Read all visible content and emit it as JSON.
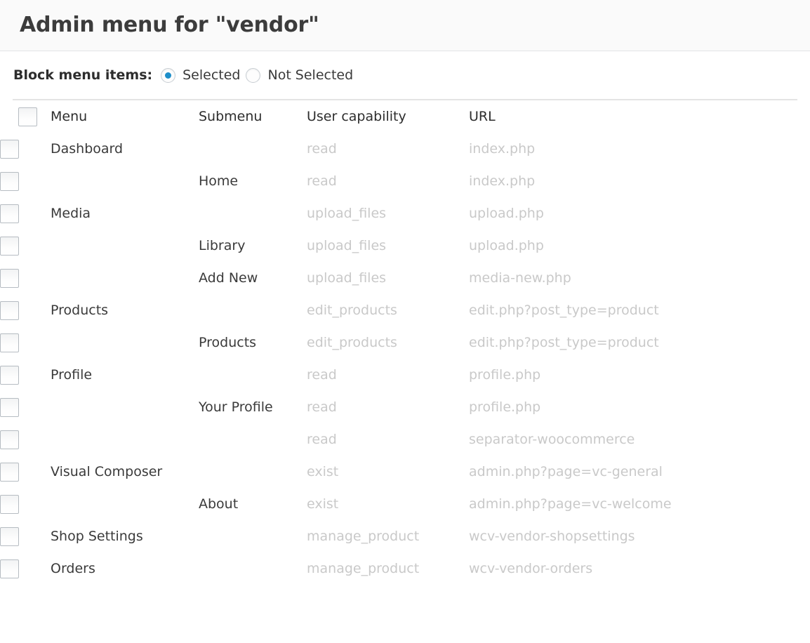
{
  "header": {
    "title": "Admin menu for \"vendor\""
  },
  "filter": {
    "label": "Block menu items:",
    "options": [
      {
        "label": "Selected",
        "checked": true
      },
      {
        "label": "Not Selected",
        "checked": false
      }
    ],
    "accent_color": "#1d8ec9"
  },
  "table": {
    "columns": {
      "checkbox": "",
      "menu": "Menu",
      "submenu": "Submenu",
      "capability": "User capability",
      "url": "URL"
    },
    "rows": [
      {
        "checked": false,
        "menu": "Dashboard",
        "submenu": "",
        "capability": "read",
        "url": "index.php"
      },
      {
        "checked": false,
        "menu": "",
        "submenu": "Home",
        "capability": "read",
        "url": "index.php"
      },
      {
        "checked": false,
        "menu": "Media",
        "submenu": "",
        "capability": "upload_files",
        "url": "upload.php"
      },
      {
        "checked": false,
        "menu": "",
        "submenu": "Library",
        "capability": "upload_files",
        "url": "upload.php"
      },
      {
        "checked": false,
        "menu": "",
        "submenu": "Add New",
        "capability": "upload_files",
        "url": "media-new.php"
      },
      {
        "checked": false,
        "menu": "Products",
        "submenu": "",
        "capability": "edit_products",
        "url": "edit.php?post_type=product"
      },
      {
        "checked": false,
        "menu": "",
        "submenu": "Products",
        "capability": "edit_products",
        "url": "edit.php?post_type=product"
      },
      {
        "checked": false,
        "menu": "Profile",
        "submenu": "",
        "capability": "read",
        "url": "profile.php"
      },
      {
        "checked": false,
        "menu": "",
        "submenu": "Your Profile",
        "capability": "read",
        "url": "profile.php"
      },
      {
        "checked": false,
        "menu": "",
        "submenu": "",
        "capability": "read",
        "url": "separator-woocommerce"
      },
      {
        "checked": false,
        "menu": "Visual Composer",
        "submenu": "",
        "capability": "exist",
        "url": "admin.php?page=vc-general"
      },
      {
        "checked": false,
        "menu": "",
        "submenu": "About",
        "capability": "exist",
        "url": "admin.php?page=vc-welcome"
      },
      {
        "checked": false,
        "menu": "Shop Settings",
        "submenu": "",
        "capability": "manage_product",
        "url": "wcv-vendor-shopsettings"
      },
      {
        "checked": false,
        "menu": "Orders",
        "submenu": "",
        "capability": "manage_product",
        "url": "wcv-vendor-orders"
      }
    ]
  }
}
